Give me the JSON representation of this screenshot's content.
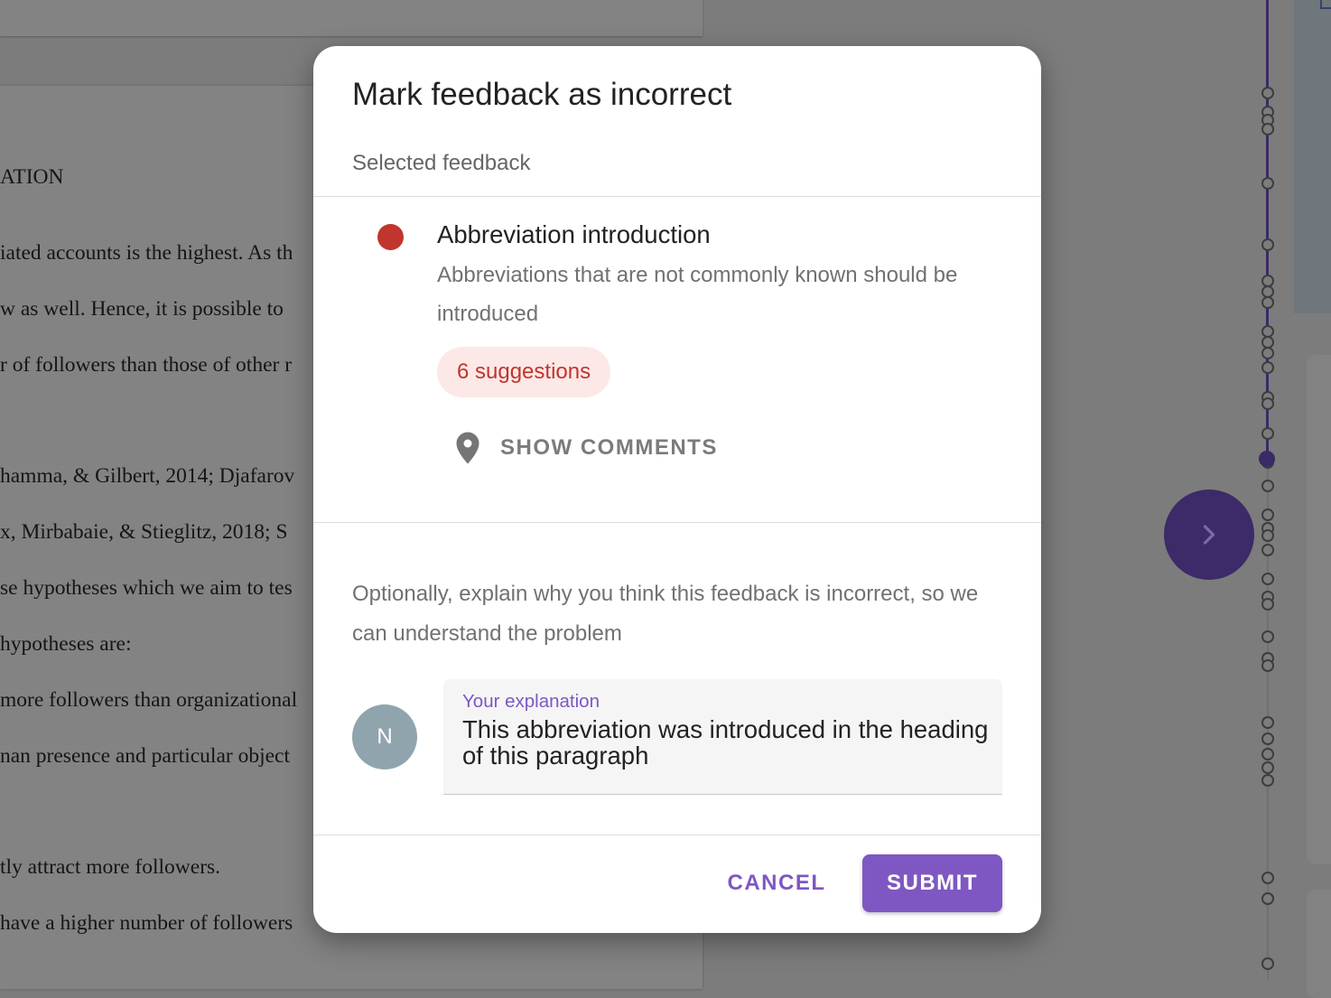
{
  "document": {
    "lines": [
      "ATION",
      "iated accounts is the highest. As th",
      "w as well. Hence, it is possible to",
      "r of followers than those of other r",
      "hamma, & Gilbert, 2014; Djafarov",
      "x, Mirbabaie, & Stieglitz, 2018; S",
      "se hypotheses which we aim to tes",
      "hypotheses are:",
      "more followers than organizational",
      "nan presence and particular object",
      "tly attract more followers.",
      "have a higher number of followers"
    ]
  },
  "dialog": {
    "title": "Mark feedback as incorrect",
    "selected_label": "Selected feedback",
    "feedback": {
      "title": "Abbreviation introduction",
      "description": "Abbreviations that are not commonly known should be introduced",
      "suggestions_label": "6 suggestions",
      "severity_color": "#c0352e",
      "icon": "location-pin-icon",
      "show_comments_label": "SHOW COMMENTS"
    },
    "explain_prompt": "Optionally, explain why you think this feedback is incorrect, so we can understand the problem",
    "avatar_initial": "N",
    "explanation": {
      "label": "Your explanation",
      "value": "This abbreviation was introduced in the heading of this paragraph"
    },
    "cancel_label": "CANCEL",
    "submit_label": "SUBMIT"
  },
  "colors": {
    "accent": "#7e57c2",
    "error": "#c0352e",
    "error_bg": "#fce8e6",
    "timeline_active": "#3c2a69"
  },
  "icons": {
    "next": "chevron-right-icon",
    "pin": "location-pin-icon"
  }
}
